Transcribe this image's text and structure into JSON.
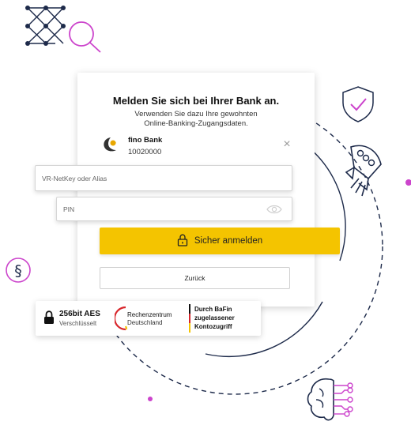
{
  "login": {
    "title": "Melden Sie sich bei Ihrer Bank an.",
    "subtitle": "Verwenden Sie dazu Ihre gewohnten Online-Banking-Zugangsdaten.",
    "bank": {
      "name": "fino Bank",
      "code": "10020000"
    },
    "fields": {
      "username_placeholder": "VR-NetKey oder Alias",
      "pin_placeholder": "PIN"
    },
    "submit_label": "Sicher anmelden",
    "back_label": "Zurück"
  },
  "trust": {
    "aes_title": "256bit AES",
    "aes_sub": "Verschlüsselt",
    "rz_line1": "Rechenzentrum",
    "rz_line2": "Deutschland",
    "bafin_line1": "Durch BaFin",
    "bafin_line2": "zugelassener",
    "bafin_line3": "Kontozugriff"
  },
  "icons": [
    "network-search-icon",
    "shield-check-icon",
    "rocket-icon",
    "paragraph-icon",
    "brain-circuit-icon",
    "lock-icon",
    "eye-icon",
    "close-icon",
    "bank-logo-icon"
  ],
  "colors": {
    "accent": "#f4c400",
    "decoration": "#cc44cc",
    "dark": "#111111"
  }
}
